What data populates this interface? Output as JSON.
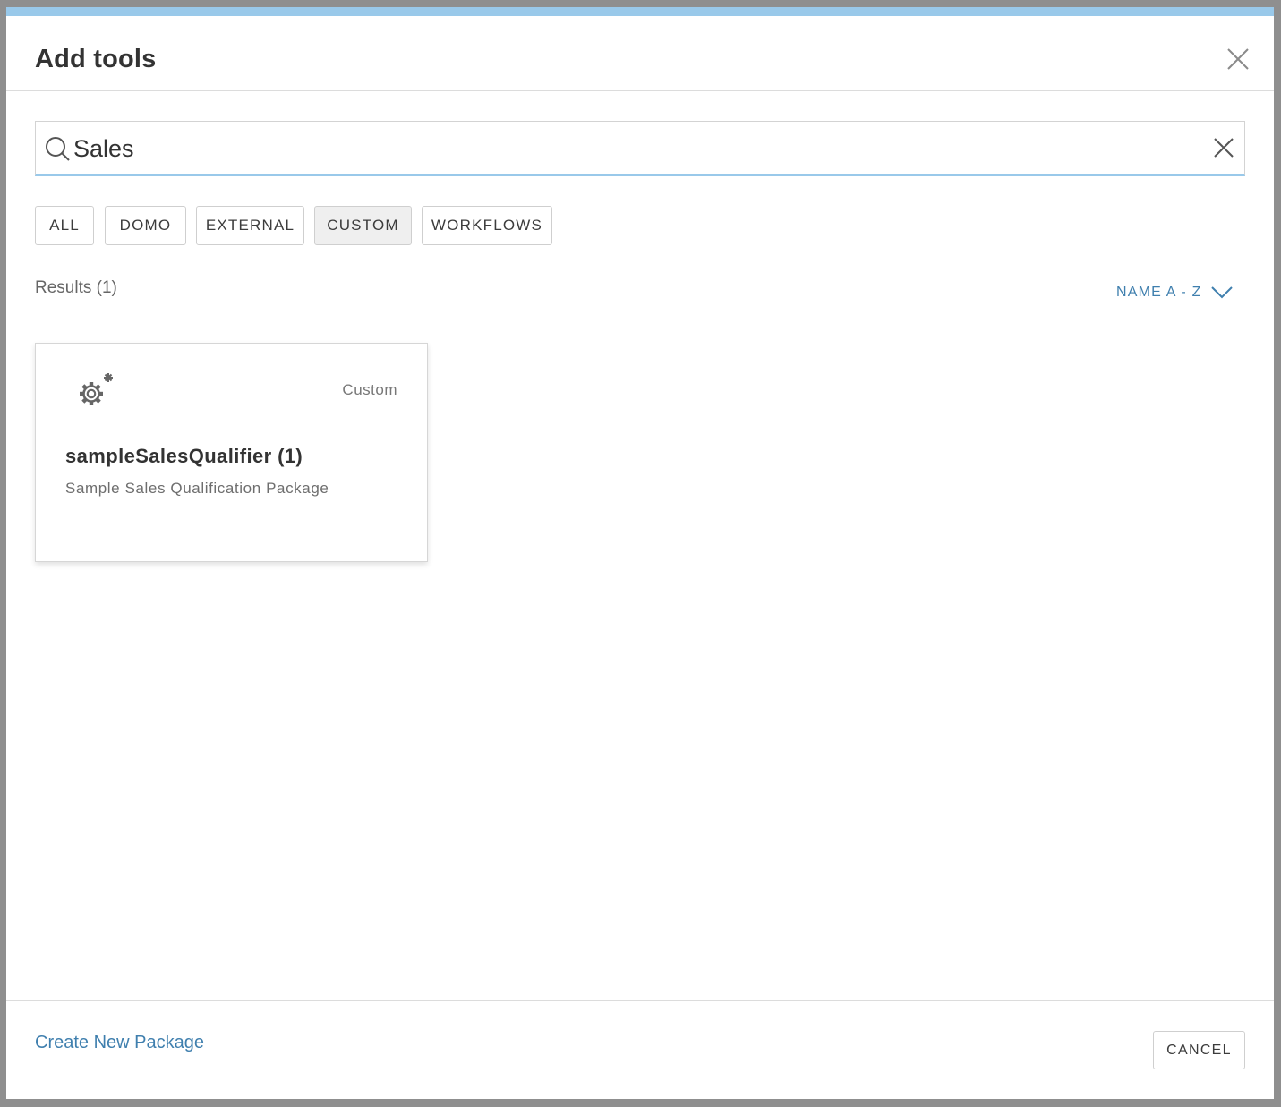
{
  "modal": {
    "title": "Add tools"
  },
  "search": {
    "value": "Sales",
    "placeholder": ""
  },
  "filters": [
    {
      "label": "ALL",
      "active": false
    },
    {
      "label": "DOMO",
      "active": false
    },
    {
      "label": "EXTERNAL",
      "active": false
    },
    {
      "label": "CUSTOM",
      "active": true
    },
    {
      "label": "WORKFLOWS",
      "active": false
    }
  ],
  "results": {
    "label": "Results (1)",
    "sort_label": "NAME A - Z"
  },
  "cards": [
    {
      "icon": "gear-icon",
      "type": "Custom",
      "title": "sampleSalesQualifier (1)",
      "description": "Sample Sales Qualification Package"
    }
  ],
  "footer": {
    "create_link": "Create New Package",
    "cancel_label": "CANCEL"
  },
  "colors": {
    "accent": "#3f7fae",
    "top_bar": "#99c9ea",
    "active_chip": "#efefef"
  }
}
